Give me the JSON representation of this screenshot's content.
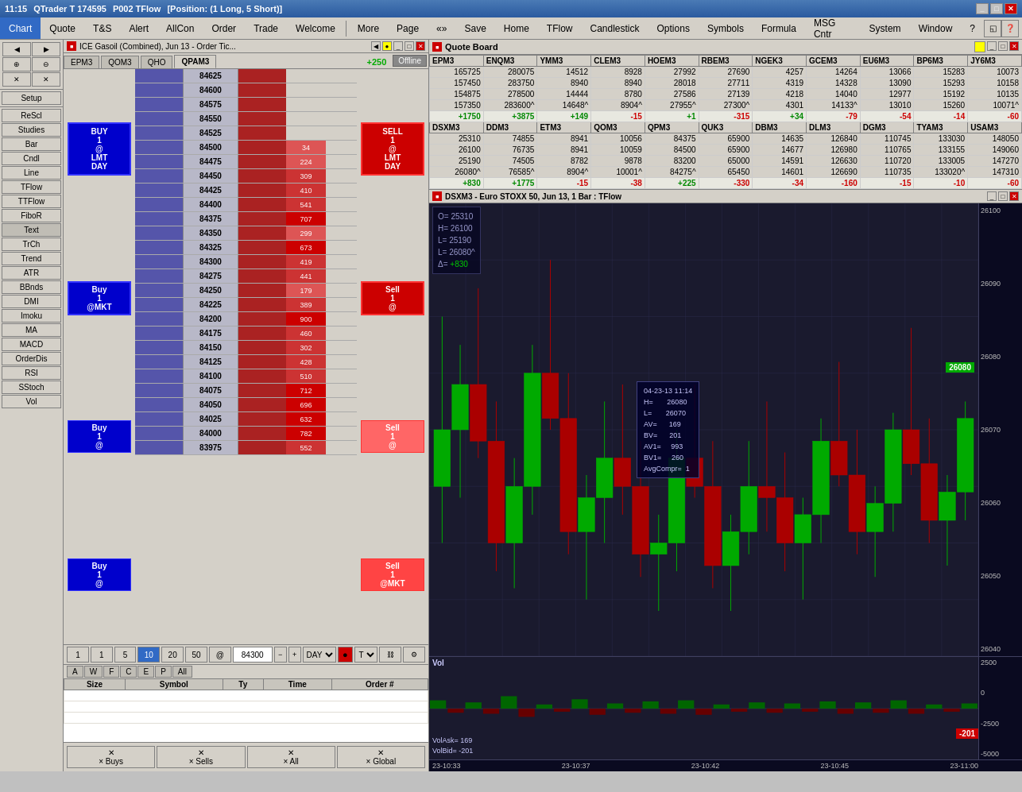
{
  "titlebar": {
    "time": "11:15",
    "app": "QTrader T 174595",
    "account": "P002 TFlow",
    "position": "[Position: (1 Long, 5 Short)]",
    "controls": [
      "_",
      "□",
      "✕"
    ]
  },
  "menubar": {
    "items": [
      "Chart",
      "Quote",
      "T&S",
      "Alert",
      "AllCon",
      "Order",
      "Trade",
      "Welcome",
      "More",
      "Page",
      "«»",
      "Save",
      "Home",
      "TFlow",
      "Candlestick",
      "Options",
      "Symbols",
      "Formula",
      "MSG Cntr",
      "System",
      "Window",
      "?"
    ]
  },
  "sidebar": {
    "top_buttons": [
      "▶",
      "◀",
      "⊕",
      "⊖",
      "×",
      "×"
    ],
    "label_setup": "Setup",
    "items": [
      "ReScl",
      "Studies",
      "Bar",
      "Cndl",
      "Line",
      "TFlow",
      "TTFlow",
      "FiboR",
      "Text",
      "TrCh",
      "Trend",
      "ATR",
      "BBnds",
      "DMI",
      "Imoku",
      "MA",
      "MACD",
      "OrderDis",
      "RSI",
      "SStoch",
      "Vol"
    ]
  },
  "orderbook": {
    "title": "ICE Gasoil (Combined), Jun 13 - Order Tic...",
    "tabs": [
      "EPM3",
      "QOM3",
      "QHO",
      "QPAM3"
    ],
    "active_tab": "QPAM3",
    "delta": "+250",
    "status": "Offline",
    "buy_orders": [
      {
        "action": "BUY 1 @ LMT DAY",
        "price": "84625",
        "sell_action": "",
        "vol": ""
      },
      {
        "action": "",
        "price": "84600",
        "sell_action": "Sell",
        "vol": ""
      },
      {
        "action": "",
        "price": "84575",
        "sell_action": "",
        "vol": ""
      },
      {
        "action": "",
        "price": "84550",
        "sell_action": "",
        "vol": ""
      },
      {
        "action": "Buy",
        "price": "84525",
        "sell_action": "Sell",
        "vol": ""
      },
      {
        "action": "",
        "price": "84500",
        "sell_action": "",
        "vol": "34"
      },
      {
        "action": "",
        "price": "84475",
        "sell_action": "",
        "vol": "224"
      },
      {
        "action": "Buy",
        "price": "84450",
        "sell_action": "Sell",
        "vol": "309"
      },
      {
        "action": "",
        "price": "84425",
        "sell_action": "",
        "vol": "410"
      },
      {
        "action": "",
        "price": "84400",
        "sell_action": "",
        "vol": "541"
      },
      {
        "action": "Buy",
        "price": "84375",
        "sell_action": "Sell",
        "vol": "707"
      },
      {
        "action": "",
        "price": "84350",
        "sell_action": "",
        "vol": "299"
      },
      {
        "action": "",
        "price": "84325",
        "sell_action": "",
        "vol": "673"
      },
      {
        "action": "",
        "price": "84300",
        "sell_action": "",
        "vol": "419"
      },
      {
        "action": "Buy",
        "price": "84300",
        "sell_action": "Sell",
        "vol": "441"
      },
      {
        "action": "",
        "price": "84275",
        "sell_action": "",
        "vol": "179"
      },
      {
        "action": "",
        "price": "84250",
        "sell_action": "",
        "vol": "389"
      },
      {
        "action": "Buy",
        "price": "84225",
        "sell_action": "Sell",
        "vol": "900"
      },
      {
        "action": "",
        "price": "84200",
        "sell_action": "",
        "vol": "460"
      },
      {
        "action": "",
        "price": "84175",
        "sell_action": "",
        "vol": "302"
      },
      {
        "action": "Buy",
        "price": "84150",
        "sell_action": "Sell",
        "vol": "428"
      },
      {
        "action": "",
        "price": "84125",
        "sell_action": "",
        "vol": "510"
      },
      {
        "action": "Buy",
        "price": "84100",
        "sell_action": "Sell",
        "vol": "712"
      },
      {
        "action": "",
        "price": "84075",
        "sell_action": "",
        "vol": "696"
      },
      {
        "action": "",
        "price": "84050",
        "sell_action": "",
        "vol": "632"
      },
      {
        "action": "",
        "price": "84025",
        "sell_action": "",
        "vol": "782"
      },
      {
        "action": "Buy",
        "price": "84000",
        "sell_action": "Sell",
        "vol": "552"
      },
      {
        "action": "",
        "price": "83975",
        "sell_action": "",
        "vol": ""
      }
    ],
    "right_orders": [
      {
        "label": "SELL 1 @ LMT DAY",
        "type": "sell"
      },
      {
        "label": "Sell 1 @",
        "type": "sell"
      },
      {
        "label": "Sell 1 @",
        "type": "sell_small"
      },
      {
        "label": "Sell 1 @ @MKT",
        "type": "sell_mkt"
      }
    ],
    "left_orders": [
      {
        "label": "BUY 1 @ LMT DAY",
        "type": "buy"
      },
      {
        "label": "Buy 1 @MKT",
        "type": "buy_small"
      },
      {
        "label": "Buy 1 @",
        "type": "buy_small2"
      },
      {
        "label": "Buy 1 @",
        "type": "buy_small3"
      }
    ],
    "qty_buttons": [
      "1",
      "1",
      "5",
      "10",
      "20",
      "50",
      "@"
    ],
    "price_input": "84300",
    "controls": [
      "DAY",
      "T"
    ],
    "order_tabs": [
      "A",
      "W",
      "F",
      "C",
      "E",
      "P",
      "All"
    ],
    "order_cols": [
      "Size",
      "Symbol",
      "Ty",
      "Time",
      "Order #"
    ],
    "bottom_buttons": [
      "× Buys",
      "× Sells",
      "× All",
      "× Global"
    ]
  },
  "quoteboard": {
    "title": "Quote Board",
    "symbols": [
      {
        "sym": "EPM3",
        "O": "165725",
        "H": "157450",
        "L": "154875",
        "C": "157350",
        "delta": "+1750"
      },
      {
        "sym": "ENQM3",
        "O": "280075",
        "H": "283750",
        "L": "278500",
        "C": "283600^",
        "delta": "+3875"
      },
      {
        "sym": "YMM3",
        "O": "14512",
        "H": "8940",
        "L": "14444",
        "C": "14648^",
        "delta": "+149"
      },
      {
        "sym": "CLEM3",
        "O": "8928",
        "H": "8940",
        "L": "8780",
        "C": "8904^",
        "delta": "-15"
      },
      {
        "sym": "HOEM3",
        "O": "27992",
        "H": "28018",
        "L": "27586",
        "C": "27955^",
        "delta": "+1"
      },
      {
        "sym": "RBEM3",
        "O": "27690",
        "H": "27711",
        "L": "27139",
        "C": "27300^",
        "delta": "-315"
      },
      {
        "sym": "NGEK3",
        "O": "4257",
        "H": "4319",
        "L": "4218",
        "C": "4301",
        "delta": "+34"
      },
      {
        "sym": "GCEM3",
        "O": "14264",
        "H": "14328",
        "L": "14040",
        "C": "14133^",
        "delta": "-79"
      },
      {
        "sym": "EU6M3",
        "O": "13066",
        "H": "13090",
        "L": "12977",
        "C": "13010",
        "delta": "-54"
      },
      {
        "sym": "BP6M3",
        "O": "15283",
        "H": "15293",
        "L": "15192",
        "C": "15260",
        "delta": "-14"
      },
      {
        "sym": "JY6M3",
        "O": "10073",
        "H": "10158",
        "L": "10135",
        "C": "10071^",
        "delta": "-60"
      },
      {
        "sym": "DSXM3",
        "O": "25310",
        "H": "26100",
        "L": "25190",
        "C": "26080^",
        "delta": "+830"
      },
      {
        "sym": "DDM3",
        "O": "74855",
        "H": "76735",
        "L": "74505",
        "C": "76585^",
        "delta": "+1775"
      },
      {
        "sym": "ETM3",
        "O": "8941",
        "H": "8941",
        "L": "8782",
        "C": "8904^",
        "delta": "-15"
      },
      {
        "sym": "QOM3",
        "O": "10056",
        "H": "10059",
        "L": "9878",
        "C": "10001^",
        "delta": "-38"
      },
      {
        "sym": "QPM3",
        "O": "84375",
        "H": "84500",
        "L": "83200",
        "C": "84275^",
        "delta": "+225"
      },
      {
        "sym": "QUK3",
        "O": "65900",
        "H": "65900",
        "L": "65000",
        "C": "65450",
        "delta": "-330"
      },
      {
        "sym": "DBM3",
        "O": "14635",
        "H": "14677",
        "L": "14591",
        "C": "14601",
        "delta": "-34"
      },
      {
        "sym": "DLM3",
        "O": "126840",
        "H": "126980",
        "L": "126630",
        "C": "126690",
        "delta": "-160"
      },
      {
        "sym": "DGM3",
        "O": "110745",
        "H": "110765",
        "L": "110720",
        "C": "110735",
        "delta": "-15"
      },
      {
        "sym": "TYAM3",
        "O": "133030",
        "H": "133155",
        "L": "133005",
        "C": "133020^",
        "delta": "-10"
      },
      {
        "sym": "USAM3",
        "O": "148050",
        "H": "149060",
        "L": "147270",
        "C": "147310",
        "delta": "-60"
      }
    ]
  },
  "chart": {
    "title": "DSXM3 - Euro STOXX 50, Jun 13, 1 Bar : TFlow",
    "info": {
      "O": "25310",
      "H": "26100",
      "L": "25190",
      "L2": "26080^",
      "delta": "+830"
    },
    "price_levels": [
      "26100",
      "26090",
      "26080",
      "26070",
      "26060",
      "26050",
      "26040"
    ],
    "current_price": "26080",
    "time_labels": [
      "23-10:33",
      "23-10:37",
      "23-10:42",
      "23-10:45",
      "23-11:00"
    ],
    "tooltip": {
      "date": "04-23-13  11:14",
      "H": "26080",
      "L": "26070",
      "AV": "169",
      "BV": "201",
      "AV1": "993",
      "BV1": "260",
      "AvgCompr": "1"
    },
    "vol_info": {
      "label": "Vol",
      "ask": "169",
      "bid": "-201"
    },
    "vol_levels": [
      "2500",
      "0",
      "-2500",
      "-5000"
    ]
  },
  "colors": {
    "buy": "#0000cc",
    "sell": "#cc0000",
    "up_candle": "#00aa00",
    "down_candle": "#cc0000",
    "chart_bg": "#1a1a2e",
    "grid": "#2a2a4a",
    "accent": "#316ac5",
    "current_price": "#00cc00"
  }
}
